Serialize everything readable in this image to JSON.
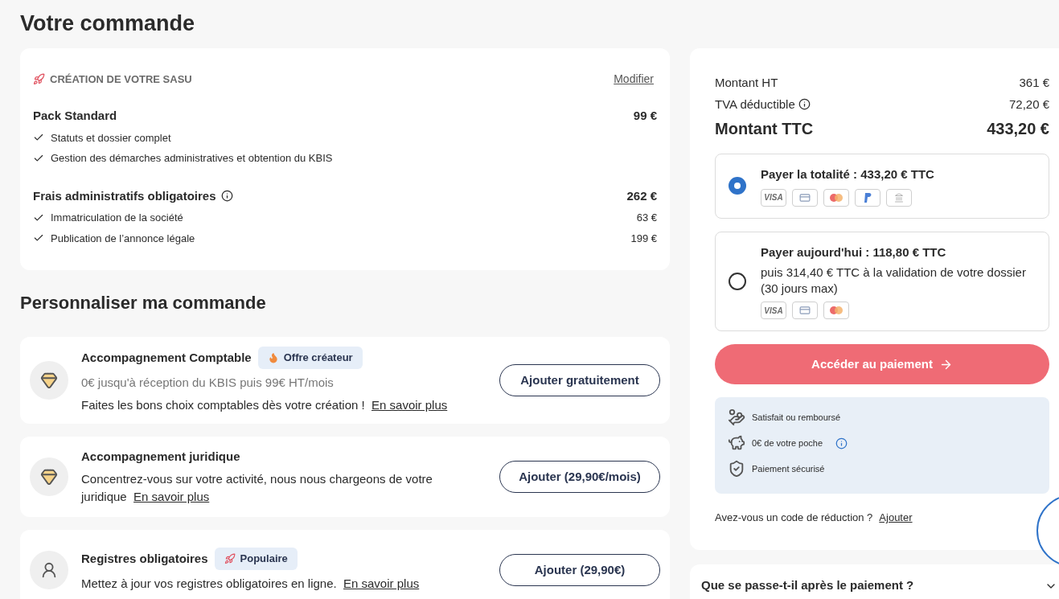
{
  "title": "Votre commande",
  "order": {
    "section_label": "CRÉATION DE VOTRE SASU",
    "modify_link": "Modifier",
    "groups": [
      {
        "name": "Pack Standard",
        "info": false,
        "price": "99 €",
        "items": [
          {
            "label": "Statuts et dossier complet"
          },
          {
            "label": "Gestion des démarches administratives et obtention du KBIS"
          }
        ]
      },
      {
        "name": "Frais administratifs obligatoires",
        "info": true,
        "price": "262 €",
        "items": [
          {
            "label": "Immatriculation de la société",
            "price": "63 €"
          },
          {
            "label": "Publication de l’annonce légale",
            "price": "199 €"
          }
        ]
      }
    ]
  },
  "customize": {
    "title": "Personnaliser ma commande",
    "options": [
      {
        "kind": "diamond",
        "name": "Accompagnement Comptable",
        "badge": {
          "kind": "flame",
          "label": "Offre créateur"
        },
        "subtitle": "0€ jusqu'à réception du KBIS puis 99€ HT/mois",
        "description": "Faites les bons choix comptables dès votre création !",
        "link": "En savoir plus",
        "button": "Ajouter gratuitement"
      },
      {
        "kind": "diamond",
        "name": "Accompagnement juridique",
        "description": "Concentrez-vous sur votre activité, nous nous chargeons de votre juridique",
        "link": "En savoir plus",
        "button": "Ajouter (29,90€/mois)"
      },
      {
        "kind": "person",
        "name": "Registres obligatoires",
        "badge": {
          "kind": "rocket",
          "label": "Populaire"
        },
        "description": "Mettez à jour vos registres obligatoires en ligne.",
        "link": "En savoir plus",
        "button": "Ajouter (29,90€)"
      }
    ]
  },
  "summary": {
    "lines": [
      {
        "kind": "line",
        "label": "Montant HT",
        "info": false,
        "value": "361 €"
      },
      {
        "kind": "line",
        "label": "TVA déductible",
        "info": true,
        "value": "72,20 €"
      },
      {
        "kind": "total",
        "label": "Montant TTC",
        "info": false,
        "value": "433,20 €"
      }
    ],
    "payment_options": [
      {
        "title": "Payer la totalité : 433,20 € TTC",
        "selected": true,
        "methods": [
          {
            "kind": "visa",
            "label": "VISA"
          },
          {
            "kind": "card"
          },
          {
            "kind": "mastercard"
          },
          {
            "kind": "paypal"
          },
          {
            "kind": "bank"
          }
        ]
      },
      {
        "title": "Payer aujourd'hui : 118,80 € TTC",
        "subtitle": "puis 314,40 € TTC à la validation de votre dossier (30 jours max)",
        "selected": false,
        "methods": [
          {
            "kind": "visa",
            "label": "VISA"
          },
          {
            "kind": "card"
          },
          {
            "kind": "mastercard"
          }
        ]
      }
    ],
    "cta": "Accéder au paiement",
    "guarantees": [
      {
        "kind": "refund",
        "label": "Satisfait ou remboursé",
        "info": false
      },
      {
        "kind": "piggy",
        "label": "0€ de votre poche",
        "info": true
      },
      {
        "kind": "card",
        "label": "Paiement sécurisé",
        "info": false
      }
    ],
    "discount": {
      "text": "Avez-vous un code de réduction ?",
      "link": "Ajouter"
    }
  },
  "faq": {
    "question": "Que se passe-t-il après le paiement ?",
    "expanded": false
  }
}
